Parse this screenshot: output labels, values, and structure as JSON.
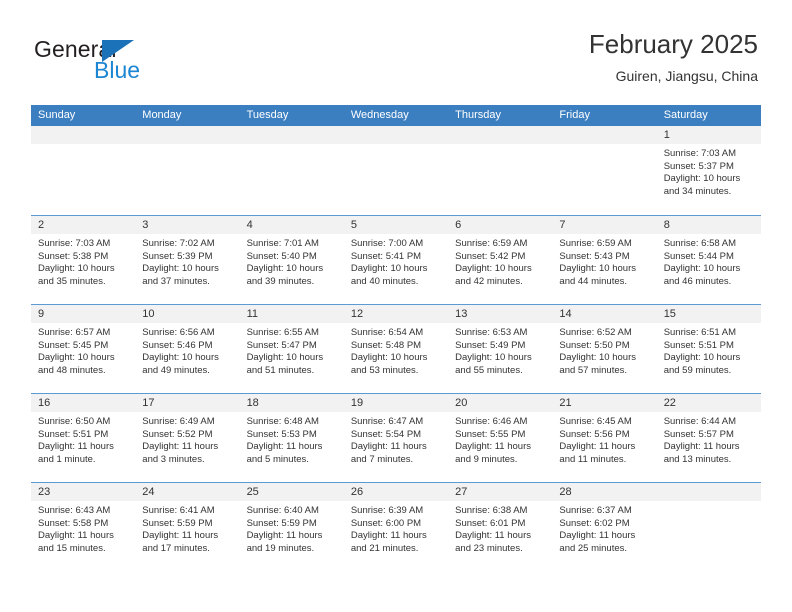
{
  "brand": {
    "name_top": "General",
    "name_bottom": "Blue"
  },
  "header": {
    "title": "February 2025",
    "location": "Guiren, Jiangsu, China"
  },
  "calendar": {
    "weekdays": [
      "Sunday",
      "Monday",
      "Tuesday",
      "Wednesday",
      "Thursday",
      "Friday",
      "Saturday"
    ],
    "header_bg": "#3c7fc1",
    "row_separator": "#5b9bd5",
    "daynum_bg": "#f2f2f2",
    "weeks": [
      [
        {
          "empty": true
        },
        {
          "empty": true
        },
        {
          "empty": true
        },
        {
          "empty": true
        },
        {
          "empty": true
        },
        {
          "empty": true
        },
        {
          "day": "1",
          "sunrise": "Sunrise: 7:03 AM",
          "sunset": "Sunset: 5:37 PM",
          "daylight": "Daylight: 10 hours and 34 minutes."
        }
      ],
      [
        {
          "day": "2",
          "sunrise": "Sunrise: 7:03 AM",
          "sunset": "Sunset: 5:38 PM",
          "daylight": "Daylight: 10 hours and 35 minutes."
        },
        {
          "day": "3",
          "sunrise": "Sunrise: 7:02 AM",
          "sunset": "Sunset: 5:39 PM",
          "daylight": "Daylight: 10 hours and 37 minutes."
        },
        {
          "day": "4",
          "sunrise": "Sunrise: 7:01 AM",
          "sunset": "Sunset: 5:40 PM",
          "daylight": "Daylight: 10 hours and 39 minutes."
        },
        {
          "day": "5",
          "sunrise": "Sunrise: 7:00 AM",
          "sunset": "Sunset: 5:41 PM",
          "daylight": "Daylight: 10 hours and 40 minutes."
        },
        {
          "day": "6",
          "sunrise": "Sunrise: 6:59 AM",
          "sunset": "Sunset: 5:42 PM",
          "daylight": "Daylight: 10 hours and 42 minutes."
        },
        {
          "day": "7",
          "sunrise": "Sunrise: 6:59 AM",
          "sunset": "Sunset: 5:43 PM",
          "daylight": "Daylight: 10 hours and 44 minutes."
        },
        {
          "day": "8",
          "sunrise": "Sunrise: 6:58 AM",
          "sunset": "Sunset: 5:44 PM",
          "daylight": "Daylight: 10 hours and 46 minutes."
        }
      ],
      [
        {
          "day": "9",
          "sunrise": "Sunrise: 6:57 AM",
          "sunset": "Sunset: 5:45 PM",
          "daylight": "Daylight: 10 hours and 48 minutes."
        },
        {
          "day": "10",
          "sunrise": "Sunrise: 6:56 AM",
          "sunset": "Sunset: 5:46 PM",
          "daylight": "Daylight: 10 hours and 49 minutes."
        },
        {
          "day": "11",
          "sunrise": "Sunrise: 6:55 AM",
          "sunset": "Sunset: 5:47 PM",
          "daylight": "Daylight: 10 hours and 51 minutes."
        },
        {
          "day": "12",
          "sunrise": "Sunrise: 6:54 AM",
          "sunset": "Sunset: 5:48 PM",
          "daylight": "Daylight: 10 hours and 53 minutes."
        },
        {
          "day": "13",
          "sunrise": "Sunrise: 6:53 AM",
          "sunset": "Sunset: 5:49 PM",
          "daylight": "Daylight: 10 hours and 55 minutes."
        },
        {
          "day": "14",
          "sunrise": "Sunrise: 6:52 AM",
          "sunset": "Sunset: 5:50 PM",
          "daylight": "Daylight: 10 hours and 57 minutes."
        },
        {
          "day": "15",
          "sunrise": "Sunrise: 6:51 AM",
          "sunset": "Sunset: 5:51 PM",
          "daylight": "Daylight: 10 hours and 59 minutes."
        }
      ],
      [
        {
          "day": "16",
          "sunrise": "Sunrise: 6:50 AM",
          "sunset": "Sunset: 5:51 PM",
          "daylight": "Daylight: 11 hours and 1 minute."
        },
        {
          "day": "17",
          "sunrise": "Sunrise: 6:49 AM",
          "sunset": "Sunset: 5:52 PM",
          "daylight": "Daylight: 11 hours and 3 minutes."
        },
        {
          "day": "18",
          "sunrise": "Sunrise: 6:48 AM",
          "sunset": "Sunset: 5:53 PM",
          "daylight": "Daylight: 11 hours and 5 minutes."
        },
        {
          "day": "19",
          "sunrise": "Sunrise: 6:47 AM",
          "sunset": "Sunset: 5:54 PM",
          "daylight": "Daylight: 11 hours and 7 minutes."
        },
        {
          "day": "20",
          "sunrise": "Sunrise: 6:46 AM",
          "sunset": "Sunset: 5:55 PM",
          "daylight": "Daylight: 11 hours and 9 minutes."
        },
        {
          "day": "21",
          "sunrise": "Sunrise: 6:45 AM",
          "sunset": "Sunset: 5:56 PM",
          "daylight": "Daylight: 11 hours and 11 minutes."
        },
        {
          "day": "22",
          "sunrise": "Sunrise: 6:44 AM",
          "sunset": "Sunset: 5:57 PM",
          "daylight": "Daylight: 11 hours and 13 minutes."
        }
      ],
      [
        {
          "day": "23",
          "sunrise": "Sunrise: 6:43 AM",
          "sunset": "Sunset: 5:58 PM",
          "daylight": "Daylight: 11 hours and 15 minutes."
        },
        {
          "day": "24",
          "sunrise": "Sunrise: 6:41 AM",
          "sunset": "Sunset: 5:59 PM",
          "daylight": "Daylight: 11 hours and 17 minutes."
        },
        {
          "day": "25",
          "sunrise": "Sunrise: 6:40 AM",
          "sunset": "Sunset: 5:59 PM",
          "daylight": "Daylight: 11 hours and 19 minutes."
        },
        {
          "day": "26",
          "sunrise": "Sunrise: 6:39 AM",
          "sunset": "Sunset: 6:00 PM",
          "daylight": "Daylight: 11 hours and 21 minutes."
        },
        {
          "day": "27",
          "sunrise": "Sunrise: 6:38 AM",
          "sunset": "Sunset: 6:01 PM",
          "daylight": "Daylight: 11 hours and 23 minutes."
        },
        {
          "day": "28",
          "sunrise": "Sunrise: 6:37 AM",
          "sunset": "Sunset: 6:02 PM",
          "daylight": "Daylight: 11 hours and 25 minutes."
        },
        {
          "empty": true
        }
      ]
    ]
  }
}
